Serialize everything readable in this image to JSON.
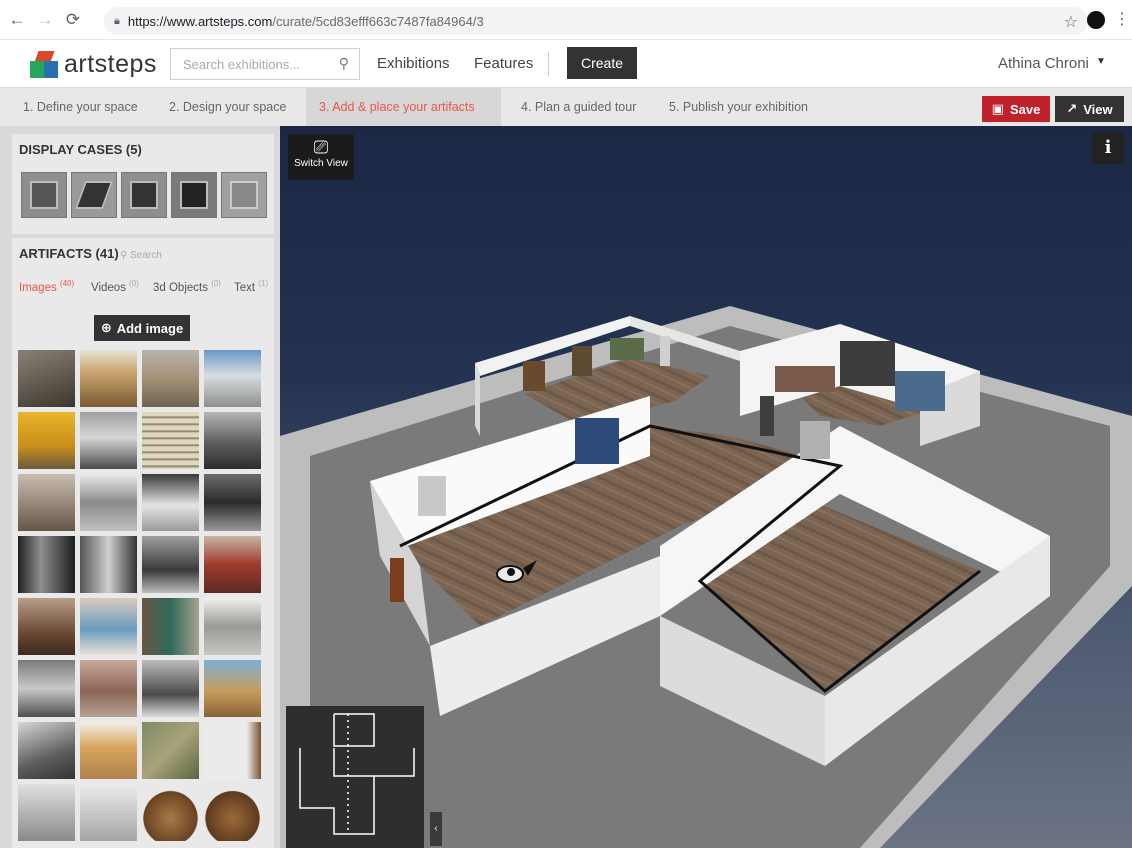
{
  "browser": {
    "url_host": "https://www.artsteps.com",
    "url_path": "/curate/5cd83efff663c7487fa84964/3"
  },
  "header": {
    "logo_text": "artsteps",
    "search_placeholder": "Search exhibitions...",
    "nav": [
      "Exhibitions",
      "Features"
    ],
    "create_label": "Create",
    "user_name": "Athina Chroni"
  },
  "steps": [
    "1. Define your space",
    "2. Design your space",
    "3. Add & place your artifacts",
    "4. Plan a guided tour",
    "5. Publish your exhibition"
  ],
  "actions": {
    "save": "Save",
    "view": "View"
  },
  "colors": {
    "accent": "#e8574a",
    "save": "#c0222b",
    "dark": "#333333"
  },
  "left_panel": {
    "display_cases_title": "DISPLAY CASES (5)",
    "artifacts_title": "ARTIFACTS (41)",
    "artifacts_search_placeholder": "Search",
    "tabs": [
      {
        "label": "Images",
        "count": "(40)"
      },
      {
        "label": "Videos",
        "count": "(0)"
      },
      {
        "label": "3d Objects",
        "count": "(0)"
      },
      {
        "label": "Text",
        "count": "(1)"
      }
    ],
    "add_image_label": "Add image"
  },
  "viewport": {
    "switch_view_label": "Switch View",
    "info_glyph": "i",
    "collapse_glyph": "‹"
  }
}
